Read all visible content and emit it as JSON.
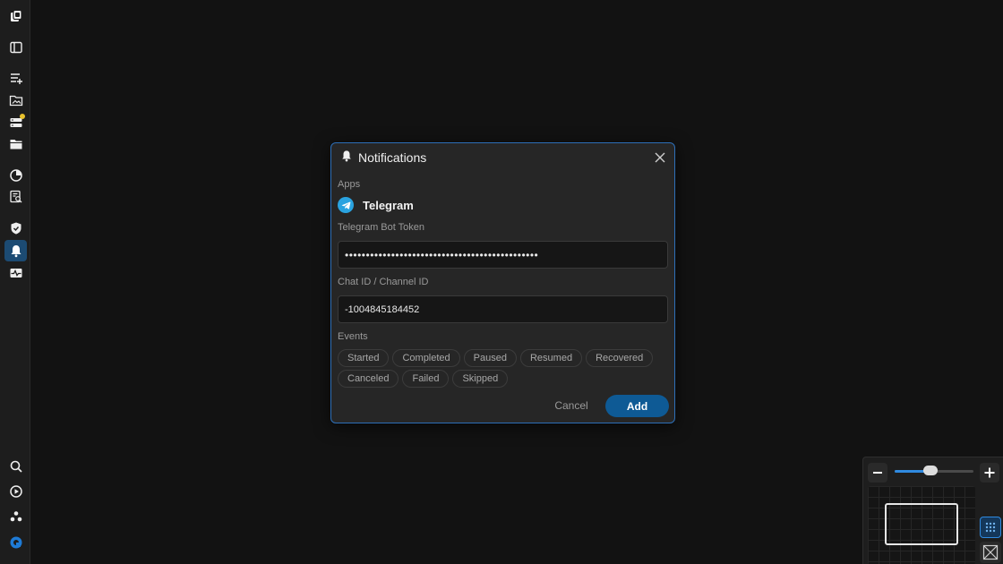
{
  "sidebar": {
    "items": [
      {
        "icon": "app-logo-icon",
        "active": false
      },
      {
        "icon": "panel-toggle-icon",
        "active": false
      },
      {
        "icon": "add-list-icon",
        "active": false
      },
      {
        "icon": "folder-image-icon",
        "active": false
      },
      {
        "icon": "storage-icon",
        "active": false,
        "badge_color": "#e8c12c"
      },
      {
        "icon": "folder-icon",
        "active": false
      },
      {
        "icon": "pie-chart-icon",
        "active": false
      },
      {
        "icon": "log-search-icon",
        "active": false
      },
      {
        "icon": "shield-icon",
        "active": false
      },
      {
        "icon": "bell-icon",
        "active": true
      },
      {
        "icon": "activity-icon",
        "active": false
      },
      {
        "icon": "search-icon",
        "active": false
      },
      {
        "icon": "play-icon",
        "active": false
      },
      {
        "icon": "community-icon",
        "active": false
      },
      {
        "icon": "brand-icon",
        "active": false
      }
    ],
    "active_color": "#1c4b73"
  },
  "dialog": {
    "title": "Notifications",
    "apps_label": "Apps",
    "app_name": "Telegram",
    "token_label": "Telegram Bot Token",
    "token_value": "••••••••••••••••••••••••••••••••••••••••••••••",
    "chat_label": "Chat ID / Channel ID",
    "chat_value": "-1004845184452",
    "events_label": "Events",
    "events": [
      "Started",
      "Completed",
      "Paused",
      "Resumed",
      "Recovered",
      "Canceled",
      "Failed",
      "Skipped"
    ],
    "cancel_label": "Cancel",
    "add_label": "Add",
    "accent_color": "#0e5a95",
    "border_color": "#2d6fb8",
    "telegram_color": "#2aa3e0"
  },
  "minimap": {
    "zoom_level": 0.45,
    "zoom_in_icon": "plus-icon",
    "zoom_out_icon": "minus-icon"
  }
}
